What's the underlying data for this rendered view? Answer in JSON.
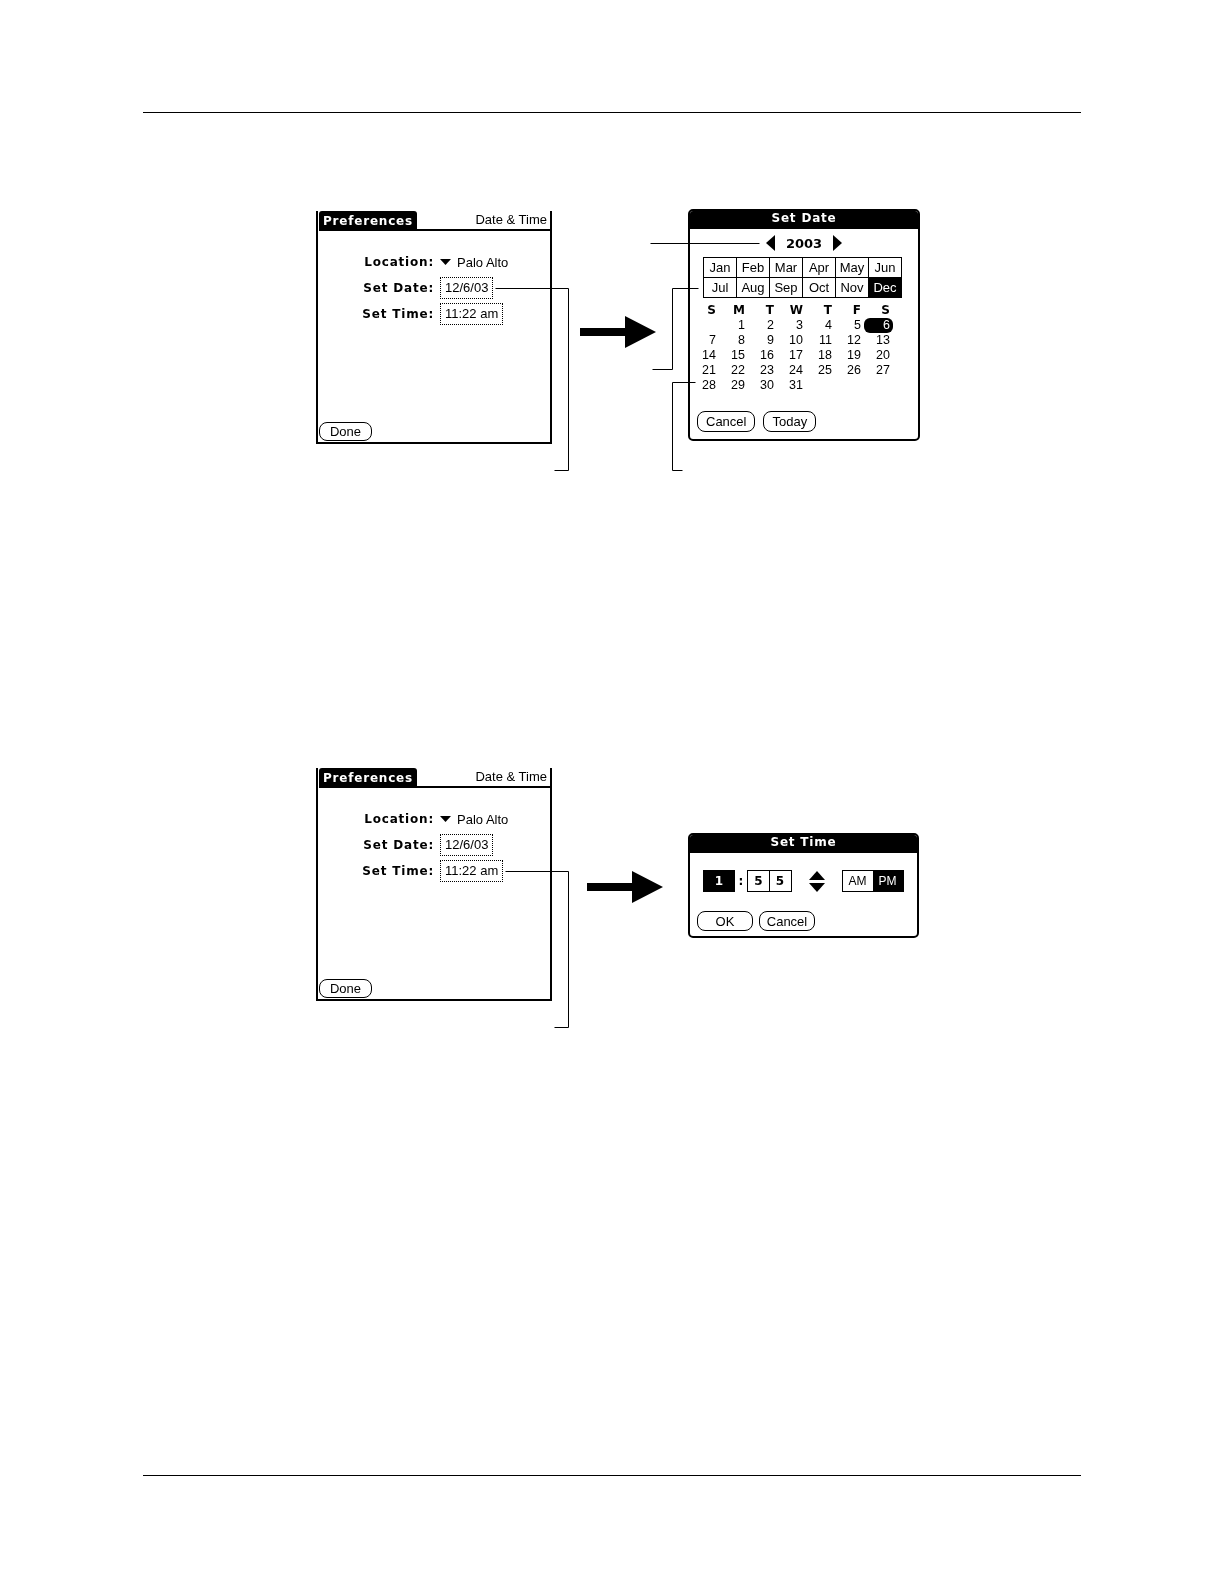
{
  "figures": [
    {
      "screen": {
        "tab": "Preferences",
        "title": "Date & Time",
        "fields": [
          {
            "kind": "dropdown",
            "label": "Location:",
            "value": "Palo Alto"
          },
          {
            "kind": "date",
            "label": "Set Date:",
            "value": "12/6/03"
          },
          {
            "kind": "time",
            "label": "Set Time:",
            "value": "11:22 am"
          }
        ],
        "button": "Done"
      },
      "dialog": {
        "kind": "date",
        "title": "Set Date",
        "year": "2003",
        "months": [
          {
            "label": "Jan",
            "selected": false
          },
          {
            "label": "Feb",
            "selected": false
          },
          {
            "label": "Mar",
            "selected": false
          },
          {
            "label": "Apr",
            "selected": false
          },
          {
            "label": "May",
            "selected": false
          },
          {
            "label": "Jun",
            "selected": false
          },
          {
            "label": "Jul",
            "selected": false
          },
          {
            "label": "Aug",
            "selected": false
          },
          {
            "label": "Sep",
            "selected": false
          },
          {
            "label": "Oct",
            "selected": false
          },
          {
            "label": "Nov",
            "selected": false
          },
          {
            "label": "Dec",
            "selected": true
          }
        ],
        "weekdays": [
          "S",
          "M",
          "T",
          "W",
          "T",
          "F",
          "S"
        ],
        "weeks": [
          [
            {
              "label": "1",
              "selected": false
            },
            {
              "label": "2",
              "selected": false
            },
            {
              "label": "3",
              "selected": false
            },
            {
              "label": "4",
              "selected": false
            },
            {
              "label": "5",
              "selected": false
            },
            {
              "label": "6",
              "selected": true
            }
          ],
          [
            {
              "label": "7",
              "selected": false
            },
            {
              "label": "8",
              "selected": false
            },
            {
              "label": "9",
              "selected": false
            },
            {
              "label": "10",
              "selected": false
            },
            {
              "label": "11",
              "selected": false
            },
            {
              "label": "12",
              "selected": false
            },
            {
              "label": "13",
              "selected": false
            }
          ],
          [
            {
              "label": "14",
              "selected": false
            },
            {
              "label": "15",
              "selected": false
            },
            {
              "label": "16",
              "selected": false
            },
            {
              "label": "17",
              "selected": false
            },
            {
              "label": "18",
              "selected": false
            },
            {
              "label": "19",
              "selected": false
            },
            {
              "label": "20",
              "selected": false
            }
          ],
          [
            {
              "label": "21",
              "selected": false
            },
            {
              "label": "22",
              "selected": false
            },
            {
              "label": "23",
              "selected": false
            },
            {
              "label": "24",
              "selected": false
            },
            {
              "label": "25",
              "selected": false
            },
            {
              "label": "26",
              "selected": false
            },
            {
              "label": "27",
              "selected": false
            }
          ],
          [
            {
              "label": "28",
              "selected": false
            },
            {
              "label": "29",
              "selected": false
            },
            {
              "label": "30",
              "selected": false
            },
            {
              "label": "31",
              "selected": false
            }
          ]
        ],
        "buttons": [
          "Cancel",
          "Today"
        ]
      }
    },
    {
      "screen": {
        "tab": "Preferences",
        "title": "Date & Time",
        "fields": [
          {
            "kind": "dropdown",
            "label": "Location:",
            "value": "Palo Alto"
          },
          {
            "kind": "date",
            "label": "Set Date:",
            "value": "12/6/03"
          },
          {
            "kind": "time",
            "label": "Set Time:",
            "value": "11:22 am"
          }
        ],
        "button": "Done"
      },
      "dialog": {
        "kind": "time",
        "title": "Set Time",
        "hour": [
          {
            "label": "1",
            "selected": true
          }
        ],
        "separator": ":",
        "minutes": [
          {
            "label": "5",
            "selected": false
          },
          {
            "label": "5",
            "selected": false
          }
        ],
        "periods": [
          {
            "label": "AM",
            "selected": false
          },
          {
            "label": "PM",
            "selected": true
          }
        ],
        "buttons": [
          "OK",
          "Cancel"
        ]
      }
    }
  ]
}
